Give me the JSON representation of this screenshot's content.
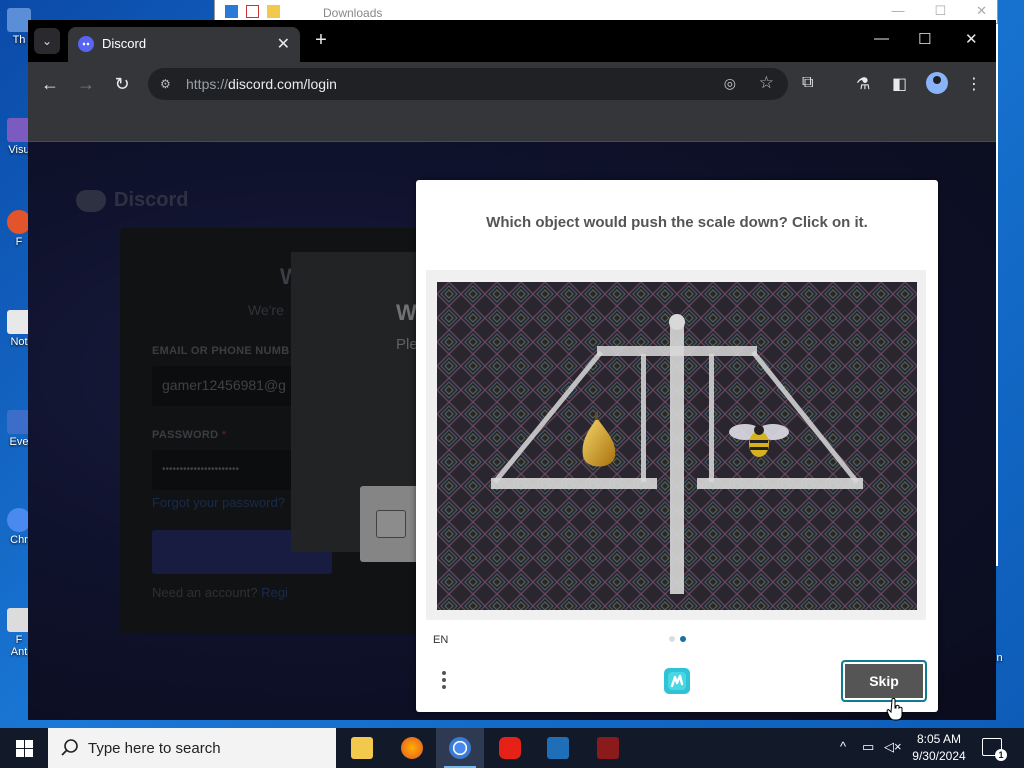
{
  "explorer": {
    "title": "Downloads"
  },
  "desktop": {
    "icons": [
      {
        "label": "Th",
        "top": 0
      },
      {
        "label": "Visu",
        "top": 0
      },
      {
        "label": "F",
        "top": 0
      },
      {
        "label": "Not",
        "top": 0
      },
      {
        "label": "Eve",
        "top": 0
      },
      {
        "label": "Chr",
        "top": 0
      },
      {
        "label": "F",
        "top": 0
      },
      {
        "label": "Ant",
        "top": 0
      }
    ],
    "right_label": "in"
  },
  "browser": {
    "tab_title": "Discord",
    "tab_close": "✕",
    "new_tab": "+",
    "url_scheme": "https://",
    "url_host": "discord.com/login",
    "back": "←",
    "forward": "→",
    "reload": "↻",
    "minimize": "—",
    "maximize": "☐",
    "close": "✕",
    "star": "☆",
    "menu": "⋮"
  },
  "discord": {
    "brand": "Discord",
    "heading_fragment": "W",
    "subheading_fragment": "We're",
    "email_label": "EMAIL OR PHONE NUMB",
    "email_value": "gamer12456981@g",
    "password_label": "PASSWORD",
    "required_mark": "*",
    "password_value": "••••••••••••••••••••••",
    "forgot": "Forgot your password?",
    "need_account": "Need an account?",
    "register": "Regi"
  },
  "hcaptcha_host": {
    "heading_fragment": "W",
    "sub_fragment": "Ple"
  },
  "captcha": {
    "prompt": "Which object would push the scale down? Click on it.",
    "language": "EN",
    "skip_label": "Skip",
    "image_objects": [
      "pear",
      "bee"
    ],
    "dot_colors": [
      "#dddddd",
      "#1a6fa8"
    ]
  },
  "taskbar": {
    "search_placeholder": "Type here to search",
    "time": "8:05 AM",
    "date": "9/30/2024",
    "notification_count": "1",
    "apps": [
      "file-explorer",
      "firefox",
      "chrome",
      "youtube",
      "virtualbox",
      "text-editor"
    ]
  }
}
